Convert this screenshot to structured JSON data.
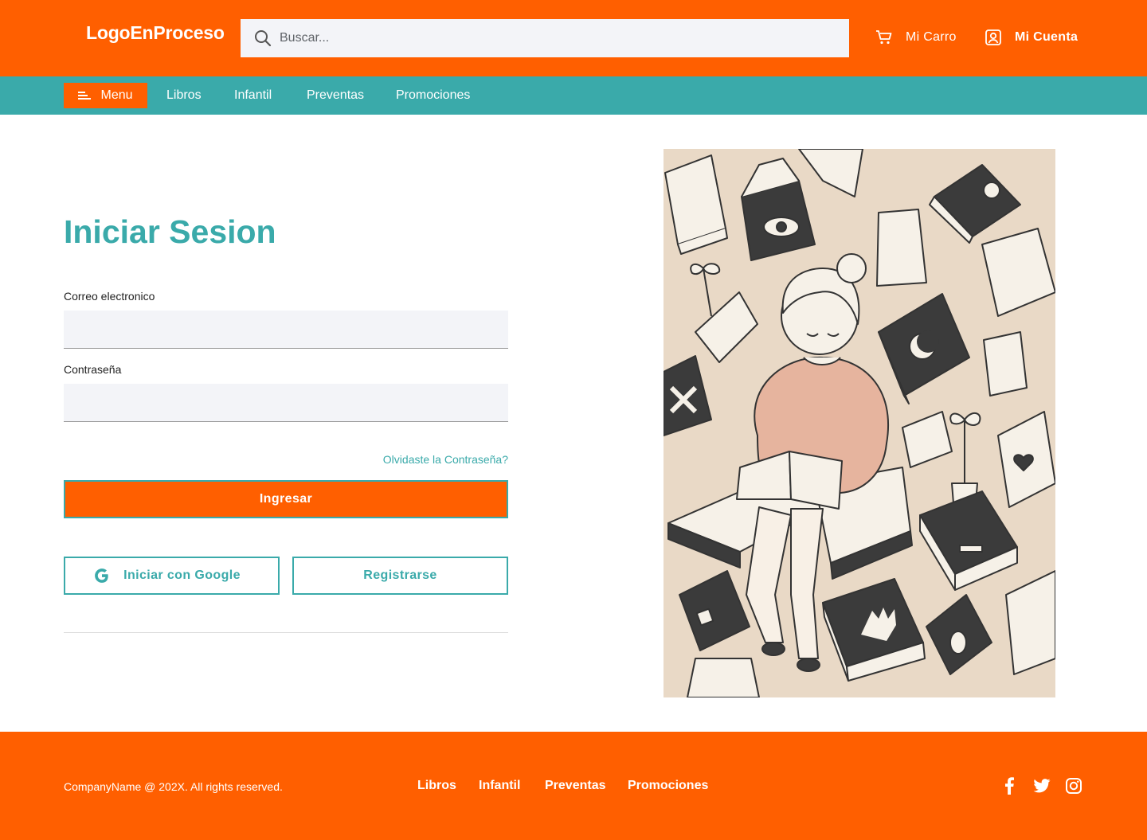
{
  "header": {
    "logo": "LogoEnProceso",
    "search_placeholder": "Buscar...",
    "cart_label": "Mi Carro",
    "account_label": "Mi Cuenta",
    "icons": [
      "search-icon",
      "cart-icon",
      "user-icon"
    ]
  },
  "nav": {
    "menu_label": "Menu",
    "items": [
      "Libros",
      "Infantil",
      "Preventas",
      "Promociones"
    ]
  },
  "login": {
    "title": "Iniciar Sesion",
    "email_label": "Correo electronico",
    "email_value": "",
    "password_label": "Contraseña",
    "password_value": "",
    "forgot_label": "Olvidaste la Contraseña?",
    "submit_label": "Ingresar",
    "google_label": "Iniciar con Google",
    "register_label": "Registrarse"
  },
  "footer": {
    "copyright": "CompanyName @ 202X. All rights reserved.",
    "links": [
      "Libros",
      "Infantil",
      "Preventas",
      "Promociones"
    ],
    "social_icons": [
      "facebook-icon",
      "twitter-icon",
      "instagram-icon"
    ]
  },
  "colors": {
    "primary": "#FF5F00",
    "secondary": "#3AAAAA",
    "input_bg": "#F3F4F8",
    "illustration_bg": "#E9D9C6"
  }
}
